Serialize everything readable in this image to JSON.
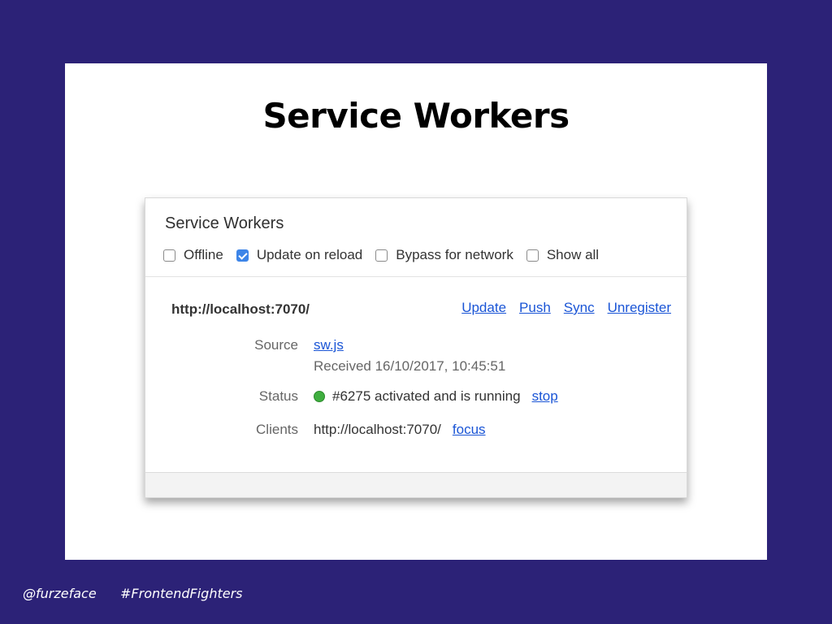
{
  "slide": {
    "title": "Service Workers"
  },
  "panel": {
    "title": "Service Workers",
    "toolbar": [
      {
        "label": "Offline",
        "checked": false
      },
      {
        "label": "Update on reload",
        "checked": true
      },
      {
        "label": "Bypass for network",
        "checked": false
      },
      {
        "label": "Show all",
        "checked": false
      }
    ],
    "origin": "http://localhost:7070/",
    "actions": {
      "update": "Update",
      "push": "Push",
      "sync": "Sync",
      "unregister": "Unregister"
    },
    "source": {
      "label": "Source",
      "file": "sw.js",
      "received": "Received 16/10/2017, 10:45:51"
    },
    "status": {
      "label": "Status",
      "text": "#6275 activated and is running",
      "action": "stop",
      "indicator_color": "#3fae3f"
    },
    "clients": {
      "label": "Clients",
      "url": "http://localhost:7070/",
      "action": "focus"
    }
  },
  "footer": {
    "handle": "@furzeface",
    "hashtag": "#FrontendFighters"
  },
  "colors": {
    "background": "#2c2277",
    "link": "#1a55d6",
    "checkbox_accent": "#3d85e8"
  }
}
